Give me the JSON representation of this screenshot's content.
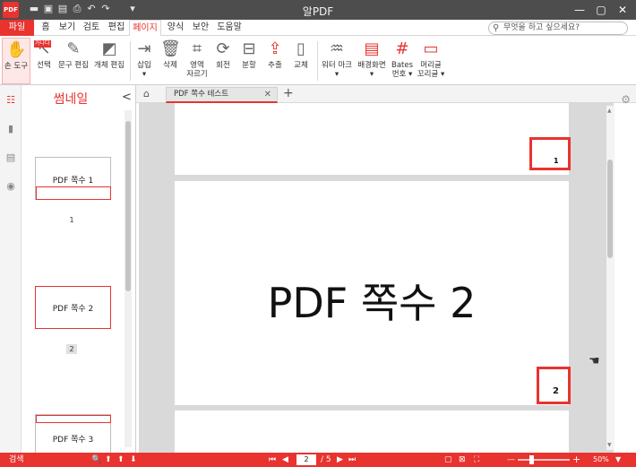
{
  "app": {
    "title": "알PDF",
    "logo_text": "PDF"
  },
  "quick_access": {
    "icons": [
      "folder-icon",
      "save-icon",
      "save-all-icon",
      "print-icon",
      "undo-icon",
      "redo-icon",
      "customize-icon"
    ],
    "glyphs": [
      "▬",
      "▣",
      "▤",
      "⎙",
      "↶",
      "↷",
      "▾"
    ]
  },
  "window_controls": {
    "minimize": "—",
    "maximize": "▢",
    "close": "✕"
  },
  "menu": {
    "items": [
      {
        "label": "파일"
      },
      {
        "label": "홈"
      },
      {
        "label": "보기"
      },
      {
        "label": "검토"
      },
      {
        "label": "편집"
      },
      {
        "label": "페이지"
      },
      {
        "label": "양식"
      },
      {
        "label": "보안"
      },
      {
        "label": "도움말"
      }
    ],
    "active": "페이지"
  },
  "search": {
    "placeholder": "무엇을 하고 싶으세요?",
    "icon": "search-icon"
  },
  "ribbon": {
    "buttons": [
      {
        "label": "손 도구",
        "icon": "hand-icon",
        "glyph": "✋",
        "selected": true
      },
      {
        "label": "선택",
        "icon": "select-icon",
        "glyph": "↖",
        "badge": "가나다"
      },
      {
        "label": "문구 편집",
        "icon": "text-edit-icon",
        "glyph": "✎"
      },
      {
        "label": "개체 편집",
        "icon": "object-edit-icon",
        "glyph": "◩"
      },
      {
        "label": "삽입",
        "sublabel": "▾",
        "icon": "insert-icon",
        "glyph": "⇥"
      },
      {
        "label": "삭제",
        "icon": "delete-icon",
        "glyph": "🗑"
      },
      {
        "label": "영역",
        "sublabel": "자르기",
        "icon": "crop-icon",
        "glyph": "⌗"
      },
      {
        "label": "회전",
        "icon": "rotate-icon",
        "glyph": "⟳"
      },
      {
        "label": "분할",
        "icon": "split-icon",
        "glyph": "⊟"
      },
      {
        "label": "추출",
        "icon": "extract-icon",
        "glyph": "⇪"
      },
      {
        "label": "교체",
        "icon": "replace-icon",
        "glyph": "▯"
      },
      {
        "label": "워터 마크",
        "sublabel": "▾",
        "icon": "watermark-icon",
        "glyph": "♒"
      },
      {
        "label": "배경화면",
        "sublabel": "▾",
        "icon": "background-icon",
        "glyph": "▤"
      },
      {
        "label": "Bates",
        "sublabel": "번호 ▾",
        "icon": "bates-icon",
        "glyph": "#"
      },
      {
        "label": "머리글",
        "sublabel": "꼬리글 ▾",
        "icon": "header-footer-icon",
        "glyph": "▭"
      }
    ]
  },
  "left_rail": {
    "icons": [
      {
        "name": "thumbnails-icon",
        "glyph": "☷",
        "color": "#e8332f"
      },
      {
        "name": "bookmarks-icon",
        "glyph": "▮",
        "color": "#888888"
      },
      {
        "name": "comments-icon",
        "glyph": "▤",
        "color": "#888888"
      },
      {
        "name": "search-panel-icon",
        "glyph": "◉",
        "color": "#888888"
      }
    ]
  },
  "thumbnails": {
    "title": "썸네일",
    "close": "<",
    "pages": [
      {
        "label": "PDF 쪽수 1",
        "number": "1"
      },
      {
        "label": "PDF 쪽수 2",
        "number": "2"
      },
      {
        "label": "PDF 쪽수 3",
        "number": ""
      }
    ]
  },
  "tabs": {
    "home_icon": "home-icon",
    "home_glyph": "⌂",
    "doc_title": "PDF 쪽수 테스트",
    "close": "✕",
    "add": "+",
    "settings_glyph": "⚙"
  },
  "document": {
    "page1_number": "1",
    "page2_text": "PDF 쪽수 2",
    "page2_number": "2",
    "cursor_glyph": "☚"
  },
  "status": {
    "search_label": "검색",
    "current_page": "2",
    "total_pages": "/ 5",
    "zoom": "50%",
    "zoom_minus": "—",
    "zoom_plus": "+",
    "nav": {
      "first": "⏮",
      "prev": "◀",
      "next": "▶",
      "last": "⏭"
    },
    "find_icons": [
      "🔍",
      "⬆",
      "⬆",
      "⬇"
    ],
    "view_icons": [
      "▢",
      "⊠",
      "⛶"
    ]
  },
  "colors": {
    "accent": "#e8332f",
    "titlebar": "#4d4d4d",
    "viewer_bg": "#d9d9d9"
  }
}
